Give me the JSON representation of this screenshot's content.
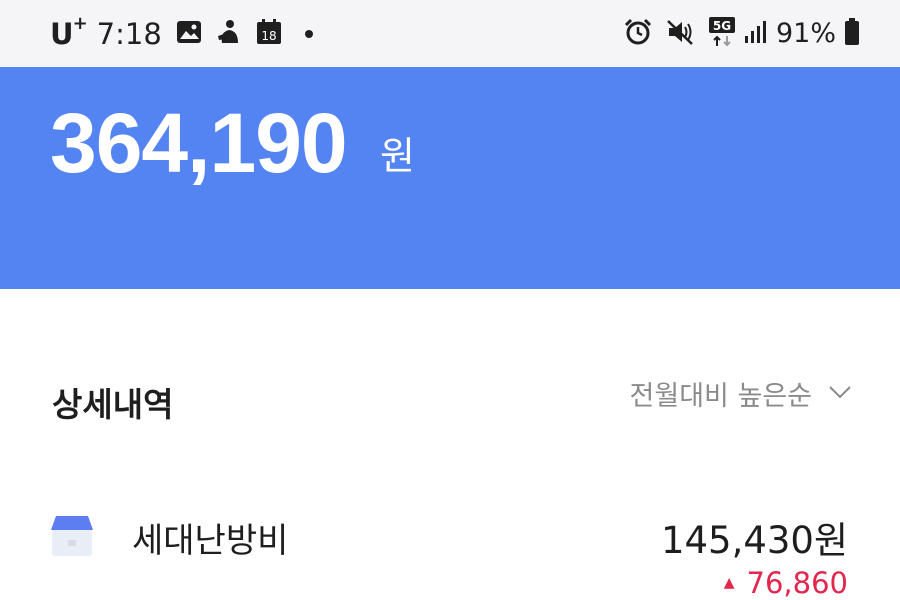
{
  "status_bar": {
    "carrier": "U",
    "carrier_plus": "+",
    "time": "7:18",
    "calendar_day": "18",
    "network": "5G",
    "battery_percent": "91%",
    "left_icons": [
      "gallery-icon",
      "figure-icon",
      "calendar-icon",
      "dot-icon"
    ],
    "right_icons": [
      "alarm-icon",
      "mute-icon",
      "5g-icon",
      "signal-icon",
      "battery-icon"
    ]
  },
  "header": {
    "amount": "364,190",
    "unit": "원",
    "background_color": "#5384f2"
  },
  "details": {
    "title": "상세내역",
    "sort_label": "전월대비 높은순",
    "sort_icon": "chevron-down-icon"
  },
  "items": [
    {
      "label": "세대난방비",
      "amount": "145,430원",
      "diff": "76,860",
      "diff_direction": "up",
      "diff_color": "#e2264d",
      "icon": "house-icon"
    }
  ]
}
